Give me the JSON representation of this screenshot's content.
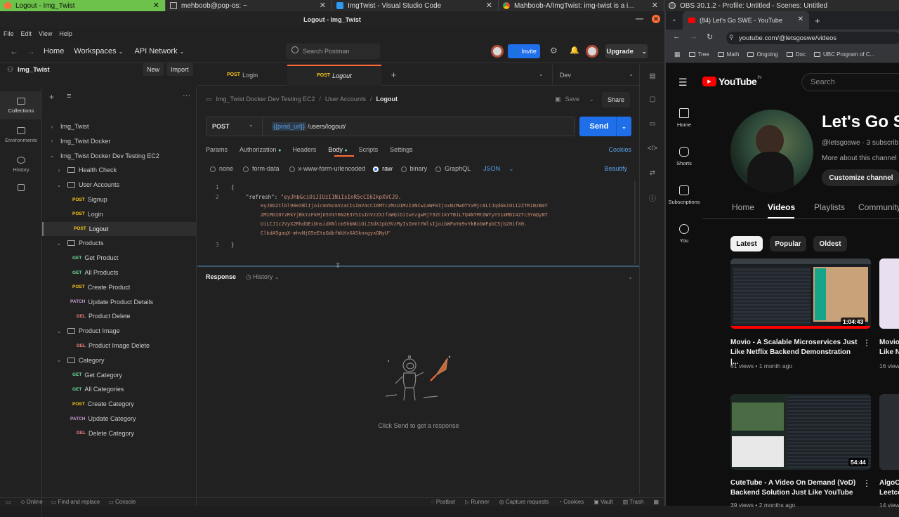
{
  "taskbar": {
    "tabs": [
      {
        "title": "Logout - Img_Twist",
        "close": "✕"
      },
      {
        "title": "mehboob@pop-os: ~",
        "close": "✕"
      },
      {
        "title": "ImgTwist - Visual Studio Code",
        "close": "✕"
      },
      {
        "title": "Mahboob-A/ImgTwist: img-twist is a i...",
        "close": "✕"
      },
      {
        "title": "OBS 30.1.2 - Profile: Untitled - Scenes: Untitled"
      }
    ]
  },
  "postman": {
    "window_title": "Logout - Img_Twist",
    "menu": [
      "File",
      "Edit",
      "View",
      "Help"
    ],
    "nav": {
      "home": "Home",
      "workspaces": "Workspaces",
      "api_network": "API Network"
    },
    "search_placeholder": "Search Postman",
    "invite": "Invite",
    "upgrade": "Upgrade",
    "workspace_name": "Img_Twist",
    "new": "New",
    "import": "Import",
    "sidebar": [
      {
        "label": "Collections"
      },
      {
        "label": "Environments"
      },
      {
        "label": "History"
      }
    ],
    "tree": [
      {
        "indent": 0,
        "chev": "›",
        "label": "Img_Twist"
      },
      {
        "indent": 0,
        "chev": "›",
        "label": "Img_Twist Docker"
      },
      {
        "indent": 0,
        "chev": "⌄",
        "label": "Img_Twist Docker Dev Testing EC2"
      },
      {
        "indent": 1,
        "chev": "›",
        "folder": true,
        "label": "Health Check"
      },
      {
        "indent": 1,
        "chev": "⌄",
        "folder": true,
        "label": "User Accounts"
      },
      {
        "indent": 2,
        "method": "POST",
        "label": "Signup"
      },
      {
        "indent": 2,
        "method": "POST",
        "label": "Login"
      },
      {
        "indent": 2,
        "method": "POST",
        "label": "Logout",
        "selected": true
      },
      {
        "indent": 1,
        "chev": "⌄",
        "folder": true,
        "label": "Products"
      },
      {
        "indent": 2,
        "method": "GET",
        "label": "Get Product"
      },
      {
        "indent": 2,
        "method": "GET",
        "label": "All Products"
      },
      {
        "indent": 2,
        "method": "POST",
        "label": "Create Product"
      },
      {
        "indent": 2,
        "method": "PATCH",
        "label": "Update Product Details"
      },
      {
        "indent": 2,
        "method": "DEL",
        "label": "Product Delete"
      },
      {
        "indent": 1,
        "chev": "⌄",
        "folder": true,
        "label": "Product Image"
      },
      {
        "indent": 2,
        "method": "DEL",
        "label": "Product Image Delete"
      },
      {
        "indent": 1,
        "chev": "⌄",
        "folder": true,
        "label": "Category"
      },
      {
        "indent": 2,
        "method": "GET",
        "label": "Get Category"
      },
      {
        "indent": 2,
        "method": "GET",
        "label": "All Categories"
      },
      {
        "indent": 2,
        "method": "POST",
        "label": "Create Category"
      },
      {
        "indent": 2,
        "method": "PATCH",
        "label": "Update Category"
      },
      {
        "indent": 2,
        "method": "DEL",
        "label": "Delete Category"
      }
    ],
    "req_tabs": [
      {
        "method": "POST",
        "label": "Login"
      },
      {
        "method": "POST",
        "label": "Logout",
        "active": true
      }
    ],
    "environment": "Dev",
    "breadcrumb": [
      "Img_Twist Docker Dev Testing EC2",
      "User Accounts",
      "Logout"
    ],
    "save": "Save",
    "share": "Share",
    "method": "POST",
    "url_var": "{{prod_url}}",
    "url_path": "/users/logout/",
    "send": "Send",
    "subtabs": [
      "Params",
      "Authorization",
      "Headers",
      "Body",
      "Scripts",
      "Settings"
    ],
    "cookies": "Cookies",
    "body_modes": [
      "none",
      "form-data",
      "x-www-form-urlencoded",
      "raw",
      "binary",
      "GraphQL"
    ],
    "format": "JSON",
    "beautify": "Beautify",
    "code": {
      "l1": "{",
      "key": "\"refresh\": ",
      "v1": "\"eyJhbGciOiJIUzI1NiIsInR5cCI6IkpXVCJ9.",
      "v2": "eyJ0b2tlbl90eXBlIjoicmVmcmVzaCIsImV4cCI6MTczMzU1MzI3NCwiaWF0IjoxNzMwOTYxMjc0LCJqdGkiOiI2ZTRiNzBmY",
      "v3": "2M1MGI0YzRkYjBkYzFkMjU5YmY0N2E3YSIsInVzZXJfaWQiOiIwYzgwMjY3ZC1kYTBiLTQ4NTMtOWYyYS1mMDI4ZTc3YmQyNT",
      "v4": "UiLCJ1c2VyX2RhdGEiOnsidXNlcm5hbWUiOiJ3dXJpb3VzMyIsImVtYWlsIjoibWFoYm9vYkBnbWFpbC5jb20ifX0.",
      "v5": "ClkdA5gaqX-mhvNjO5eEtuGdbfWiKvXASknxgyxGNyU\"",
      "l3": "}"
    },
    "response": "Response",
    "history": "History",
    "empty_msg": "Click Send to get a response",
    "status": [
      "Online",
      "Find and replace",
      "Console"
    ],
    "status_right": [
      "Postbot",
      "Runner",
      "Capture requests",
      "Cookies",
      "Vault",
      "Trash"
    ]
  },
  "browser": {
    "tab_title": "(84) Let's Go SWE - YouTube",
    "url": "youtube.com/@letsgoswe/videos",
    "bookmarks": [
      "Tree",
      "Math",
      "Ongoing",
      "Doc",
      "UBC Program of C..."
    ],
    "yt": {
      "logo": "YouTube",
      "region": "IN",
      "search": "Search",
      "nav": [
        "Home",
        "Shorts",
        "Subscriptions",
        "You"
      ],
      "channel_name": "Let's Go S",
      "handle": "@letsgoswe · 3 subscrib",
      "more": "More about this channel",
      "customize": "Customize channel",
      "tabs": [
        "Home",
        "Videos",
        "Playlists",
        "Community"
      ],
      "chips": [
        "Latest",
        "Popular",
        "Oldest"
      ],
      "videos": [
        {
          "title": "Movio - A Scalable Microservices Just Like Netflix Backend Demonstration |...",
          "meta": "61 views • 1 month ago",
          "duration": "1:04:43"
        },
        {
          "title": "CuteTube - A Video On Demand (VoD) Backend Solution Just Like YouTube",
          "meta": "39 views • 2 months ago",
          "duration": "54:44"
        }
      ],
      "partial": [
        {
          "title": "Movio Like N",
          "meta": "16 view"
        },
        {
          "title": "AlgoCo Leetco",
          "meta": "14 view"
        }
      ]
    }
  },
  "colors": {
    "accent": "#ff6c37",
    "send": "#1f6feb",
    "yt_red": "#ff0000"
  }
}
